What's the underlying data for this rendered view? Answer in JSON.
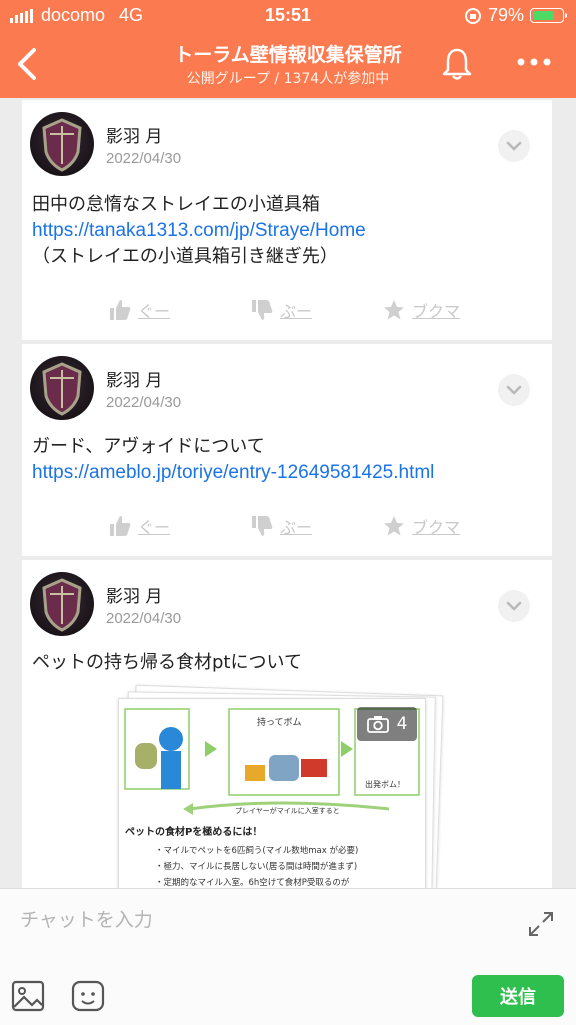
{
  "status_bar": {
    "carrier": "docomo",
    "network": "4G",
    "time": "15:51",
    "battery_percent": "79%",
    "battery_level": 0.79
  },
  "header": {
    "title": "トーラム壁情報収集保管所",
    "subtitle": "公開グループ / 1374人が参加中"
  },
  "posts": [
    {
      "author": "影羽 月",
      "date": "2022/04/30",
      "lines": [
        "田中の怠惰なストレイエの小道具箱",
        "https://tanaka1313.com/jp/Straye/Home",
        "（ストレイエの小道具箱引き継ぎ先）"
      ]
    },
    {
      "author": "影羽 月",
      "date": "2022/04/30",
      "lines": [
        "ガード、アヴォイドについて",
        "https://ameblo.jp/toriye/entry-12649581425.html"
      ]
    },
    {
      "author": "影羽 月",
      "date": "2022/04/30",
      "lines": [
        "ペットの持ち帰る食材ptについて"
      ],
      "image_count": "4",
      "image_text": [
        "持ってボム",
        "出発ボム！",
        "プレイヤーがマイルに入室すると",
        "ペットの食材Pを極めるには！",
        "・マイルでペットを6匹飼う(マイル数地max が必要)",
        "・極力、マイルに長居しない(居る間は時間が進まず)",
        "・定期的なマイル入室。6h空けて食材P受取るのが"
      ]
    }
  ],
  "actions": {
    "like": "ぐー",
    "dislike": "ぶー",
    "bookmark": "ブクマ"
  },
  "chat": {
    "placeholder": "チャットを入力",
    "send_label": "送信"
  },
  "colors": {
    "header": "#fc7a50",
    "link": "#1a73e8",
    "send": "#2fbf4e"
  }
}
